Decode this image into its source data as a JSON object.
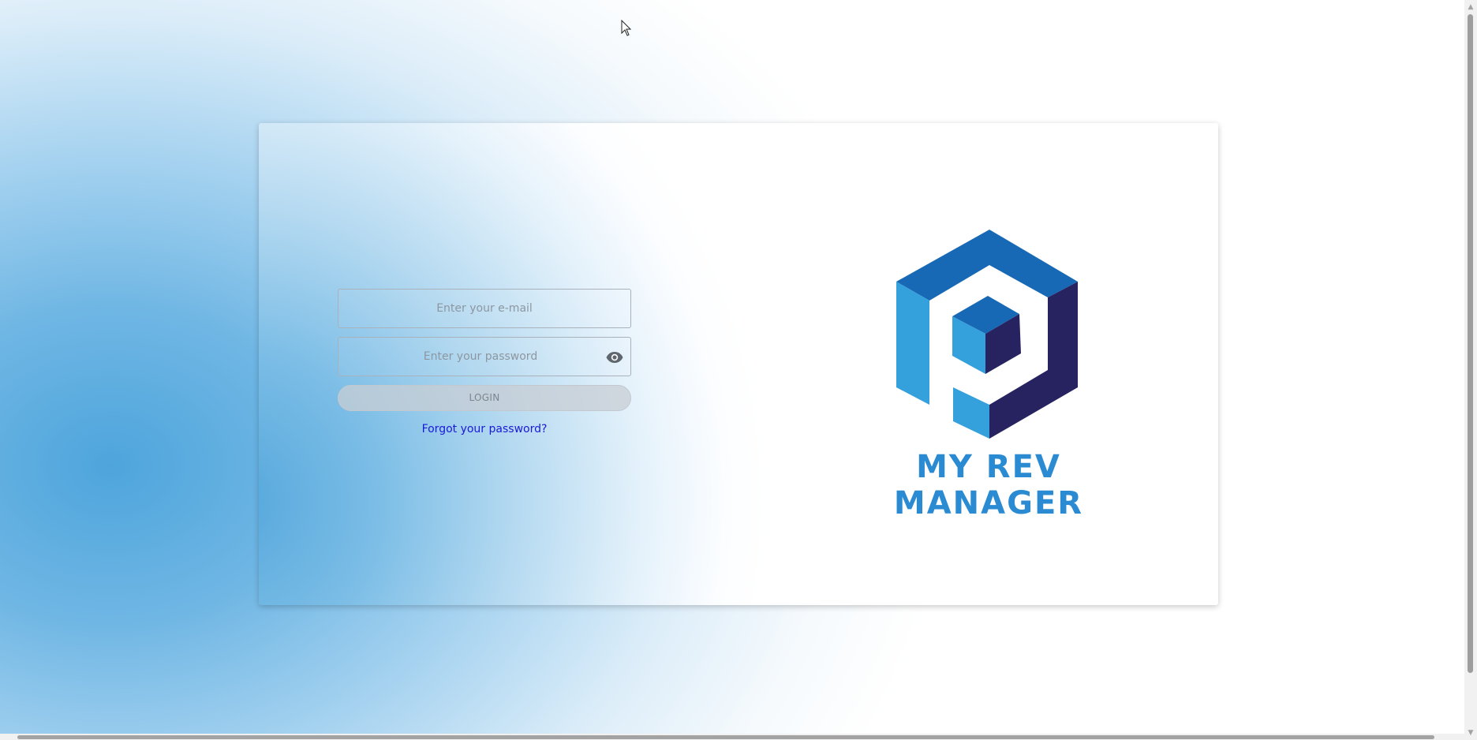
{
  "login_form": {
    "email_placeholder": "Enter your e-mail",
    "password_placeholder": "Enter your password",
    "login_label": "LOGIN",
    "forgot_label": "Forgot your password?"
  },
  "brand": {
    "name": "MY REV MANAGER",
    "logo_icon": "cube-p-logo",
    "colors": {
      "dark_blue": "#1769b5",
      "light_blue": "#34a0dc",
      "navy": "#272361",
      "text": "#2a8ad2"
    }
  },
  "icons": {
    "password_toggle": "eye-icon"
  }
}
